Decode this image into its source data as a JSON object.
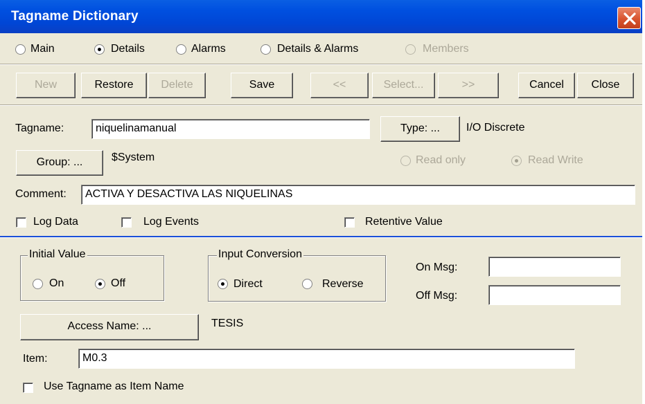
{
  "window": {
    "title": "Tagname Dictionary"
  },
  "view_tabs": [
    {
      "label": "Main",
      "selected": false,
      "enabled": true
    },
    {
      "label": "Details",
      "selected": true,
      "enabled": true
    },
    {
      "label": "Alarms",
      "selected": false,
      "enabled": true
    },
    {
      "label": "Details & Alarms",
      "selected": false,
      "enabled": true
    },
    {
      "label": "Members",
      "selected": false,
      "enabled": false
    }
  ],
  "toolbar": {
    "new": "New",
    "restore": "Restore",
    "delete": "Delete",
    "save": "Save",
    "prev": "<<",
    "select": "Select...",
    "next": ">>",
    "cancel": "Cancel",
    "close": "Close"
  },
  "tag": {
    "tagname_label": "Tagname:",
    "tagname_value": "niquelinamanual",
    "type_button": "Type: ...",
    "type_value": "I/O Discrete",
    "group_button": "Group: ...",
    "group_value": "$System",
    "read_only_label": "Read only",
    "read_write_label": "Read Write",
    "access_mode": "Read Write",
    "comment_label": "Comment:",
    "comment_value": "ACTIVA Y DESACTIVA LAS NIQUELINAS",
    "log_data_label": "Log Data",
    "log_data": false,
    "log_events_label": "Log Events",
    "log_events": false,
    "retentive_label": "Retentive Value",
    "retentive": false
  },
  "details": {
    "initial_value_title": "Initial Value",
    "on_label": "On",
    "off_label": "Off",
    "initial_value": "Off",
    "input_conversion_title": "Input Conversion",
    "direct_label": "Direct",
    "reverse_label": "Reverse",
    "input_conversion": "Direct",
    "on_msg_label": "On Msg:",
    "on_msg_value": "",
    "off_msg_label": "Off Msg:",
    "off_msg_value": "",
    "access_name_button": "Access Name: ...",
    "access_name_value": "TESIS",
    "item_label": "Item:",
    "item_value": "M0.3",
    "use_tagname_label": "Use Tagname as Item Name",
    "use_tagname": false
  },
  "colors": {
    "titlebar": "#0050e0",
    "dialog_bg": "#ece9d8",
    "close_button": "#d8542f",
    "disabled_text": "#aca899"
  }
}
